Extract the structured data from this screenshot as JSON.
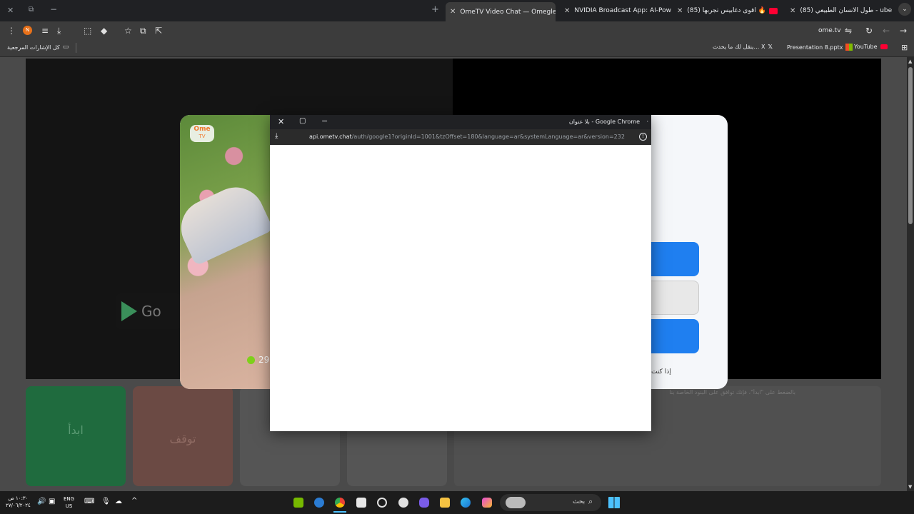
{
  "tabs": [
    {
      "title": "(85) طول الانسان الطبيعي - ube",
      "fav_color": "#ff0033",
      "active": false
    },
    {
      "title": "(85) اقوى دغابيس تجربها 🔥",
      "fav_color": "#ff0033",
      "active": false
    },
    {
      "title": "NVIDIA Broadcast App: AI-Pow",
      "fav_color": "#76b900",
      "active": false
    },
    {
      "title": "OmeTV Video Chat — Omegle",
      "fav_color": "#e85050",
      "active": true
    }
  ],
  "toolbar": {
    "address": "ome.tv",
    "avatar_letter": "N"
  },
  "bookmarks": [
    {
      "label": "YouTube",
      "color": "#ff0033"
    },
    {
      "label": "Presentation 8.pptx",
      "color": "#f25022"
    },
    {
      "label": "ينقل لك ما يحدث… X",
      "color": "#ffffff"
    }
  ],
  "bookmarks_all": "كل الإشارات المرجعية",
  "page": {
    "logo_top": "Ome",
    "logo_bottom": "TV",
    "online_count": "29",
    "google_play": "Go",
    "start_label": "ابدأ",
    "stop_label": "توقف",
    "terms_text": "بالضغط على \"ابدأ\"، فإنك توافق على البنود الخاصة بنا",
    "modal_footer": "إذا كنت"
  },
  "popup": {
    "title": "بلا عنوان - Google Chrome",
    "url_host": "api.ometv.chat",
    "url_path": "/auth/google1?originId=1001&tzOffset=180&language=ar&systemLanguage=ar&version=232"
  },
  "taskbar": {
    "search_label": "بحث",
    "lang_top": "ENG",
    "lang_bottom": "US",
    "time": "١٠:٣٠ ص",
    "date": "٢٧/٠٦/٢٠٢٤"
  }
}
